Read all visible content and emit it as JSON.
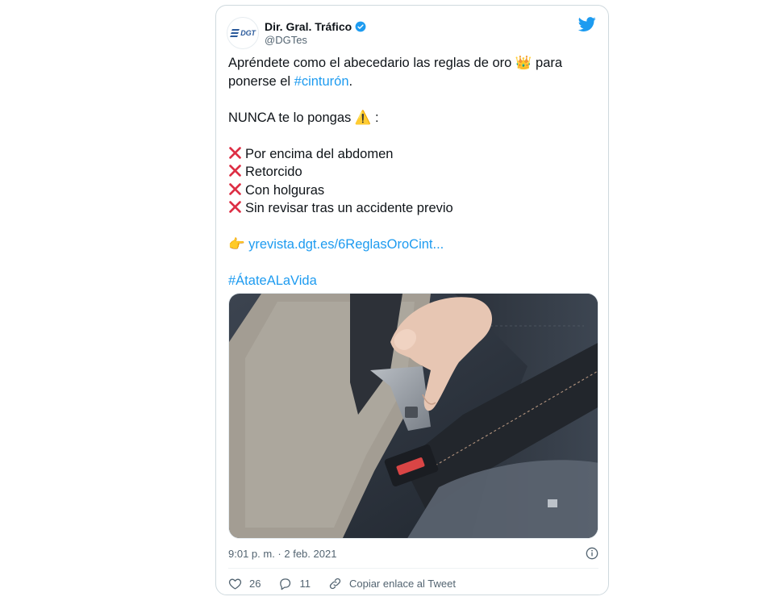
{
  "tweet": {
    "author_name": "Dir. Gral. Tráfico",
    "author_handle": "@DGTes",
    "logo_text": "DGT",
    "text": {
      "line1_a": "Apréndete como el abecedario las reglas de oro ",
      "line1_emoji": "👑",
      "line1_b": " para",
      "line2_a": "ponerse el ",
      "line2_hashtag": "#cinturón",
      "line2_b": ".",
      "warning_a": "NUNCA te lo pongas ",
      "warning_emoji": "⚠️",
      "warning_b": " :",
      "items": [
        "Por encima del abdomen",
        "Retorcido",
        "Con holguras",
        "Sin revisar tras un accidente previo"
      ],
      "link_emoji": "👉",
      "link": "yrevista.dgt.es/6ReglasOroCint...",
      "hashtag": "#ÁtateALaVida"
    },
    "timestamp": "9:01 p. m. · 2 feb. 2021",
    "likes": "26",
    "replies": "11",
    "copy_link": "Copiar enlace al Tweet"
  },
  "colors": {
    "link": "#1d9bf0",
    "text": "#0f1419",
    "muted": "#536471",
    "xmark": "#dd2e44",
    "brand": "#2a5a9b"
  },
  "icons": [
    "dgt-logo-icon",
    "verified-badge-icon",
    "twitter-bird-icon",
    "x-mark-icon",
    "info-icon",
    "heart-icon",
    "reply-icon",
    "link-icon"
  ]
}
